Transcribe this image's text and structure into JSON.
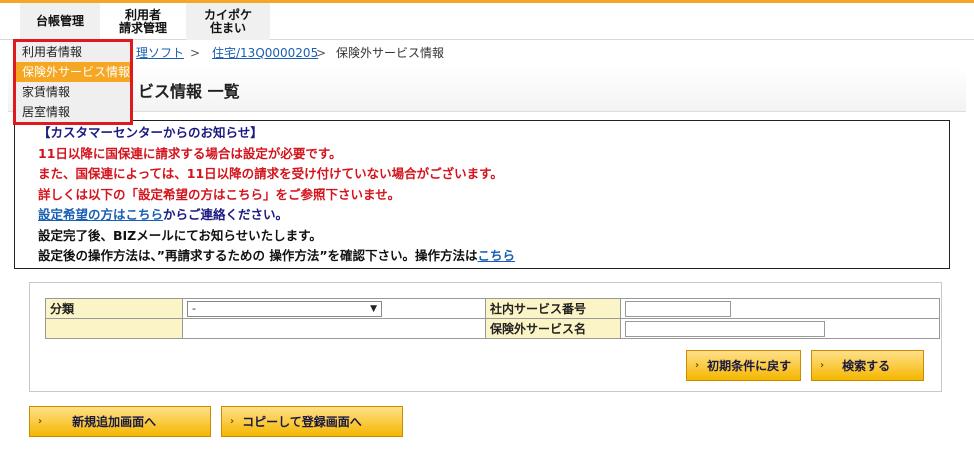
{
  "nav": {
    "tabs": [
      {
        "line1": "台帳管理",
        "line2": ""
      },
      {
        "line1": "利用者",
        "line2": "請求管理"
      },
      {
        "line1": "カイポケ",
        "line2": "住まい"
      }
    ]
  },
  "menu": {
    "items": [
      "利用者情報",
      "保険外サービス情報",
      "家賃情報",
      "居室情報"
    ],
    "active_color": "#f5a623",
    "highlight_border": "#e0191e"
  },
  "breadcrumb": {
    "link1": "理ソフト",
    "sep": ">",
    "link2": "住宅/13Q0000205",
    "current": "保険外サービス情報"
  },
  "page": {
    "title": "ビス情報 一覧"
  },
  "notice": {
    "heading": "【カスタマーセンターからのお知らせ】",
    "line1": "11日以降に国保連に請求する場合は設定が必要です。",
    "line2": "また、国保連によっては、11日以降の請求を受け付けていない場合がございます。",
    "line3": "詳しくは以下の「設定希望の方はこちら」をご参照下さいませ。",
    "line4_link": "設定希望の方はこちら",
    "line4_rest": "からご連絡ください。",
    "line5": "設定完了後、BIZメールにてお知らせいたします。",
    "line6": "設定後の操作方法は、”再請求するための 操作方法”を確認下さい。操作方法は",
    "line6_link": "こちら"
  },
  "search": {
    "category_label": "分類",
    "category_value": "-",
    "service_no_label": "社内サービス番号",
    "service_name_label": "保険外サービス名",
    "service_no_value": "",
    "service_name_value": ""
  },
  "buttons": {
    "reset": "初期条件に戻す",
    "search": "検索する",
    "new": "新規追加画面へ",
    "copy": "コピーして登録画面へ"
  },
  "colors": {
    "accent": "#f5a623",
    "notice_red": "#d3141c",
    "link": "#1a5fb4",
    "label_bg": "#fbf4c6"
  }
}
